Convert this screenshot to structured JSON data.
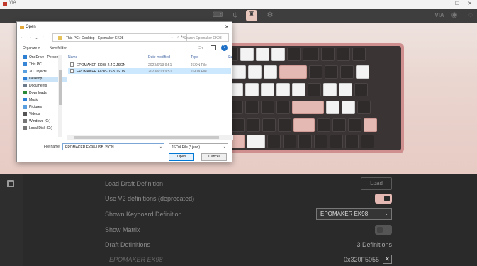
{
  "window": {
    "title": "VIA",
    "minimize": "–",
    "maximize": "☐",
    "close": "✕"
  },
  "topbar": {
    "icons": [
      "keyboard-icon",
      "usb-icon",
      "design-icon",
      "gear-icon",
      "via-icon",
      "discord-icon",
      "github-icon"
    ]
  },
  "dialog": {
    "title": "Open",
    "close": "✕",
    "nav": {
      "back": "←",
      "forward": "→",
      "down": "⌄",
      "up": "↑"
    },
    "path": [
      "This PC",
      "Desktop",
      "Epomaker EK98"
    ],
    "search_placeholder": "Search Epomaker EK98",
    "organize": "Organize ▾",
    "new_folder": "New folder",
    "nav_items": [
      {
        "label": "OneDrive - Person",
        "selected": false,
        "color": "#2c7fd1"
      },
      {
        "label": "This PC",
        "selected": false,
        "color": "#3a86d6"
      },
      {
        "label": "3D Objects",
        "selected": false,
        "color": "#5aa0e0"
      },
      {
        "label": "Desktop",
        "selected": true,
        "color": "#2d7fd5"
      },
      {
        "label": "Documents",
        "selected": false,
        "color": "#6c7a89"
      },
      {
        "label": "Downloads",
        "selected": false,
        "color": "#2a8a3a"
      },
      {
        "label": "Music",
        "selected": false,
        "color": "#2d7fd5"
      },
      {
        "label": "Pictures",
        "selected": false,
        "color": "#5aa0e0"
      },
      {
        "label": "Videos",
        "selected": false,
        "color": "#555"
      },
      {
        "label": "Windows (C:)",
        "selected": false,
        "color": "#777"
      },
      {
        "label": "Local Disk (D:)",
        "selected": false,
        "color": "#777"
      }
    ],
    "columns": [
      "Name",
      "Date modified",
      "Type",
      "Siz"
    ],
    "files": [
      {
        "name": "EPOMAKER EK98-2.4G.JSON",
        "date": "2023/6/13 9:51",
        "type": "JSON File",
        "selected": false
      },
      {
        "name": "EPOMAKER EK98-USB.JSON",
        "date": "2023/6/13 9:51",
        "type": "JSON File",
        "selected": true
      }
    ],
    "filename_label": "File name:",
    "filename_value": "EPOMAKER EK98-USB.JSON",
    "filetype": "JSON File (*.json)",
    "open_button": "Open",
    "cancel_button": "Cancel"
  },
  "settings": {
    "load_draft": {
      "label": "Load Draft Definition",
      "button": "Load"
    },
    "use_v2": {
      "label": "Use V2 definitions (deprecated)",
      "on": true
    },
    "shown_def": {
      "label": "Shown Keyboard Definition",
      "value": "EPOMAKER EK98"
    },
    "show_matrix": {
      "label": "Show Matrix",
      "on": false
    },
    "draft_defs": {
      "label": "Draft Definitions",
      "value": "3 Definitions"
    },
    "draft_item": {
      "name": "EPOMAKER EK98",
      "id": "0x320F5055",
      "remove": "✕"
    }
  }
}
